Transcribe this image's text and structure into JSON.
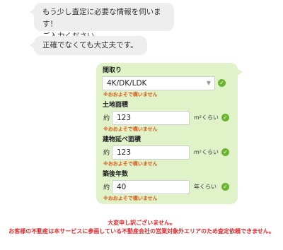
{
  "chat": {
    "message1_line1": "もう少し査定に必要な情報を伺います！",
    "message1_line2": "ご入力ください。",
    "message2": "正確でなくても大丈夫です。"
  },
  "form": {
    "madori": {
      "label": "間取り",
      "value": "4K/DK/LDK",
      "hint": "※おおよそで構いません"
    },
    "land_area": {
      "label": "土地面積",
      "prefix": "約",
      "value": "123",
      "unit": "m²くらい",
      "hint": "※おおよそで構いません"
    },
    "floor_area": {
      "label": "建物延べ面積",
      "prefix": "約",
      "value": "123",
      "unit": "m²くらい",
      "hint": "※おおよそで構いません"
    },
    "age": {
      "label": "築後年数",
      "prefix": "約",
      "value": "40",
      "unit": "年くらい",
      "hint": "※おおよそで構いません"
    },
    "check_icon": "check-circle-icon"
  },
  "error": {
    "line1": "大変申し訳ございません。",
    "line2": "お客様の不動産は本サービスに参画している不動産会社の営業対象外エリアのため査定依頼できません。"
  },
  "colors": {
    "accent_green": "#6ab42f",
    "form_bg": "#dff2c8",
    "hint_orange": "#e05a1a",
    "error_red": "#e0282d"
  }
}
